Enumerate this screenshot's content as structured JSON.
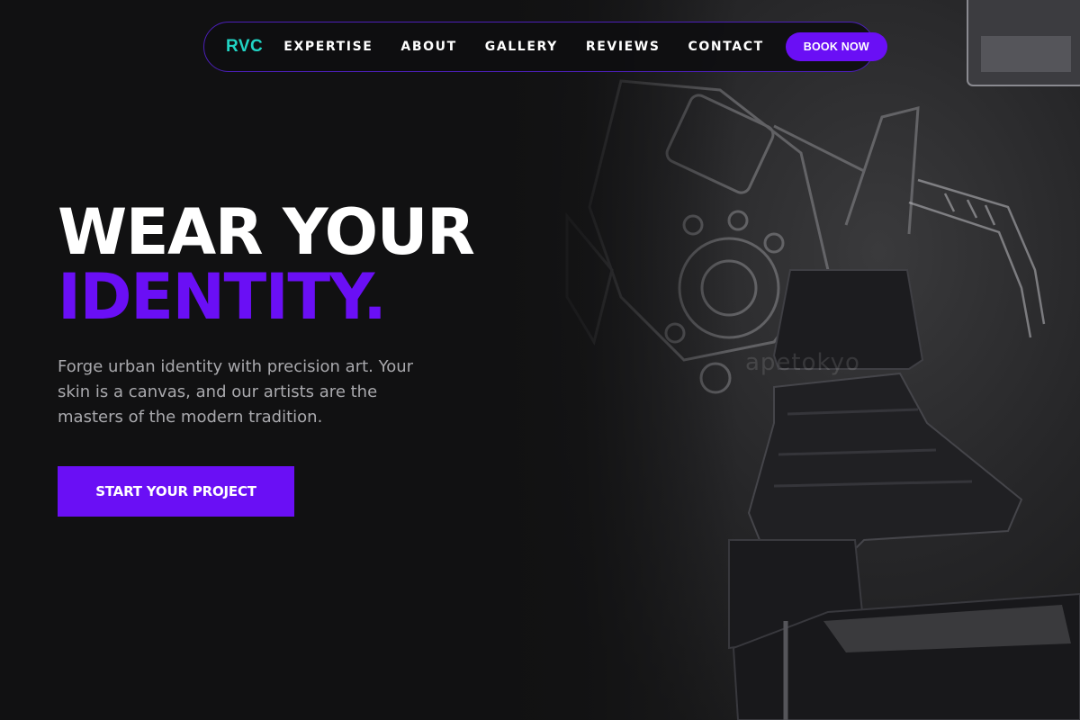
{
  "brand": {
    "logo": "RVC",
    "accent_color": "#6a0ff5",
    "logo_color": "#21d4c4"
  },
  "nav": {
    "links": [
      "EXPERTISE",
      "ABOUT",
      "GALLERY",
      "REVIEWS",
      "CONTACT"
    ],
    "book_label": "BOOK NOW"
  },
  "hero": {
    "title_line1": "WEAR YOUR",
    "title_line2": "IDENTITY.",
    "description": "Forge urban identity with precision art. Your skin is a canvas, and our artists are the masters of the modern tradition.",
    "cta_label": "START YOUR PROJECT",
    "background_image": "tattoo-studio-chair-photo",
    "watermark": "apetokyo"
  }
}
